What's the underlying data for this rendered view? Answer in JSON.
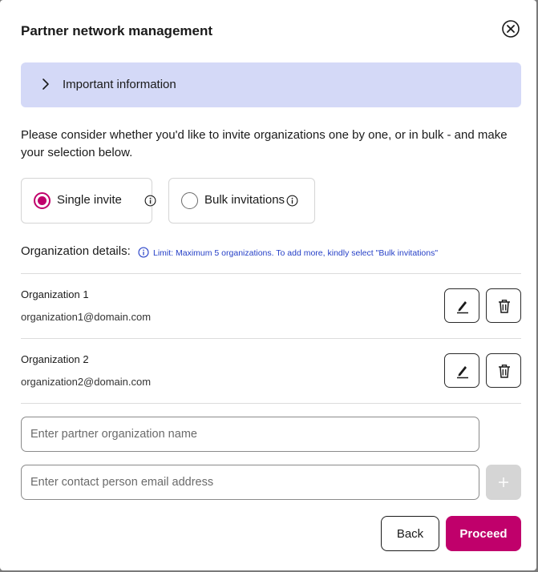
{
  "dialog": {
    "title": "Partner network management"
  },
  "info_banner": {
    "label": "Important information"
  },
  "description": "Please consider whether you'd like to invite organizations one by one, or in bulk - and make your selection below.",
  "invite_mode": {
    "options": [
      {
        "label": "Single invite",
        "selected": true
      },
      {
        "label": "Bulk invitations",
        "selected": false
      }
    ]
  },
  "org_details": {
    "label": "Organization details:",
    "limit_note": "Limit: Maximum 5 organizations. To add more, kindly select \"Bulk invitations\""
  },
  "organizations": [
    {
      "name": "Organization 1",
      "email": "organization1@domain.com"
    },
    {
      "name": "Organization 2",
      "email": "organization2@domain.com"
    }
  ],
  "form": {
    "name_placeholder": "Enter partner organization name",
    "email_placeholder": "Enter contact person email address"
  },
  "footer": {
    "back_label": "Back",
    "proceed_label": "Proceed"
  },
  "colors": {
    "accent": "#c0006b",
    "banner": "#d4d9f7",
    "info_link": "#2640c7",
    "disabled": "#d5d5d5"
  }
}
